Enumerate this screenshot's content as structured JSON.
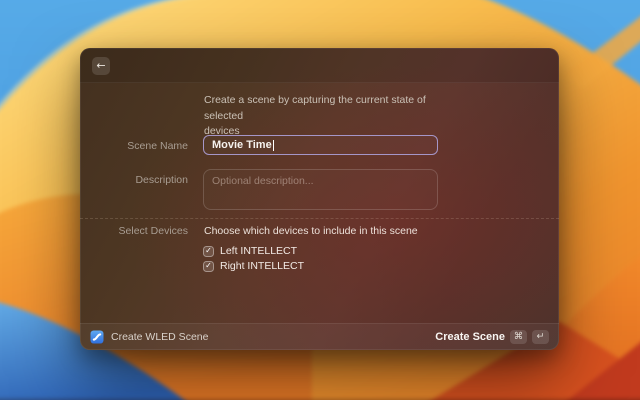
{
  "icons": {
    "back": "←",
    "check": "✓",
    "command_key": "⌘",
    "return_key": "↵"
  },
  "colors": {
    "focus_border": "#a596c8",
    "app_icon_blue": "#2f7de0",
    "wallpaper_sky": "#4a9cdc",
    "wallpaper_dune": "#f5a830"
  },
  "dialog": {
    "intro": {
      "line1": "Create a scene by capturing the current state of selected",
      "line2": "devices"
    },
    "scene_name": {
      "label": "Scene Name",
      "value": "Movie Time"
    },
    "description": {
      "label": "Description",
      "placeholder": "Optional description..."
    },
    "select_devices": {
      "label": "Select Devices",
      "helper": "Choose which devices to include in this scene",
      "options": [
        {
          "label": "Left INTELLECT",
          "checked": true
        },
        {
          "label": "Right INTELLECT",
          "checked": true
        }
      ]
    },
    "footer": {
      "app_name": "Create WLED Scene",
      "action_label": "Create Scene"
    }
  }
}
